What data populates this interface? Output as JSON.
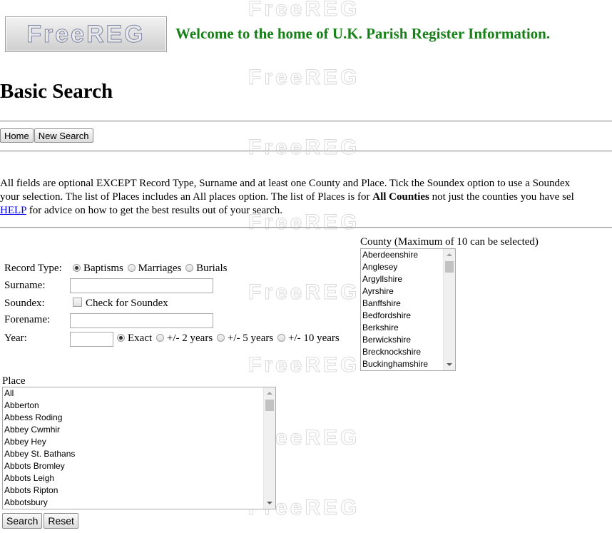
{
  "header": {
    "logo_text": "FreeREG",
    "welcome": "Welcome to the home of U.K. Parish Register Information."
  },
  "watermark_text": "FreeREG",
  "page_title": "Basic Search",
  "nav": {
    "home_label": "Home",
    "new_search_label": "New Search"
  },
  "info": {
    "line1": "All fields are optional EXCEPT Record Type, Surname and at least one County and Place. Tick the Soundex option to use a Soundex",
    "line2_pre": "your selection. The list of Places includes an All places option. The list of Places is for ",
    "line2_bold": "All Counties",
    "line2_post": " not just the counties you have sel",
    "help_link": "HELP",
    "line3_post": " for advice on how to get the best results out of your search."
  },
  "form": {
    "record_type_label": "Record Type:",
    "record_types": [
      "Baptisms",
      "Marriages",
      "Burials"
    ],
    "record_type_selected": "Baptisms",
    "surname_label": "Surname:",
    "surname_value": "",
    "soundex_label": "Soundex:",
    "soundex_checkbox_label": "Check for Soundex",
    "forename_label": "Forename:",
    "forename_value": "",
    "year_label": "Year:",
    "year_value": "",
    "year_ranges": [
      "Exact",
      "+/- 2 years",
      "+/- 5 years",
      "+/- 10 years"
    ],
    "year_range_selected": "Exact"
  },
  "county": {
    "label": "County (Maximum of 10 can be selected)",
    "options": [
      "Aberdeenshire",
      "Anglesey",
      "Argyllshire",
      "Ayrshire",
      "Banffshire",
      "Bedfordshire",
      "Berkshire",
      "Berwickshire",
      "Brecknockshire",
      "Buckinghamshire"
    ]
  },
  "place": {
    "label": "Place",
    "options": [
      "All",
      "Abberton",
      "Abbess Roding",
      "Abbey Cwmhir",
      "Abbey Hey",
      "Abbey St. Bathans",
      "Abbots Bromley",
      "Abbots Leigh",
      "Abbots Ripton",
      "Abbotsbury"
    ]
  },
  "actions": {
    "search_label": "Search",
    "reset_label": "Reset"
  },
  "colors": {
    "welcome_green": "#188018",
    "link_blue": "#0000ee"
  }
}
